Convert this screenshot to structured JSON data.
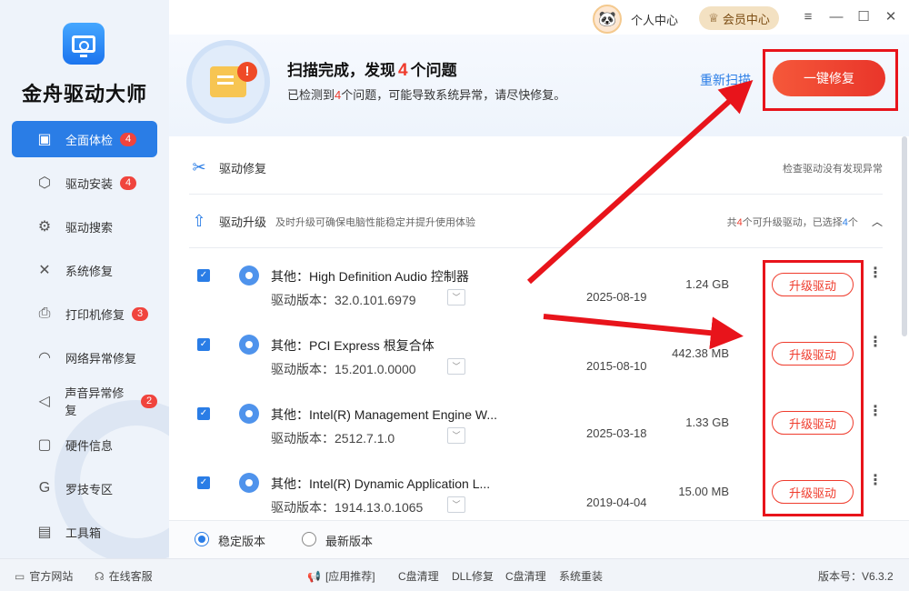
{
  "sidebar": {
    "app_name": "金舟驱动大师",
    "items": [
      {
        "label": "全面体检",
        "badge": "4",
        "icon": "monitor-icon"
      },
      {
        "label": "驱动安装",
        "badge": "4",
        "icon": "package-icon"
      },
      {
        "label": "驱动搜索",
        "badge": "",
        "icon": "search-gear-icon"
      },
      {
        "label": "系统修复",
        "badge": "",
        "icon": "tools-icon"
      },
      {
        "label": "打印机修复",
        "badge": "3",
        "icon": "printer-icon"
      },
      {
        "label": "网络异常修复",
        "badge": "",
        "icon": "wifi-icon"
      },
      {
        "label": "声音异常修复",
        "badge": "2",
        "icon": "speaker-icon"
      },
      {
        "label": "硬件信息",
        "badge": "",
        "icon": "chip-icon"
      },
      {
        "label": "罗技专区",
        "badge": "",
        "icon": "logitech-icon"
      },
      {
        "label": "工具箱",
        "badge": "",
        "icon": "toolbox-icon"
      }
    ]
  },
  "titlebar": {
    "personal_center": "个人中心",
    "vip_center": "会员中心"
  },
  "scan": {
    "title_prefix": "扫描完成，发现",
    "issue_count": "4",
    "title_suffix": "个问题",
    "sub_prefix": "已检测到",
    "sub_count": "4",
    "sub_suffix": "个问题，可能导致系统异常，请尽快修复。",
    "rescan_label": "重新扫描",
    "fix_all_label": "一键修复"
  },
  "sections": {
    "repair": {
      "title": "驱动修复",
      "right": "检查驱动没有发现异常"
    },
    "upgrade": {
      "title": "驱动升级",
      "desc": "及时升级可确保电脑性能稳定并提升使用体验",
      "right_1": "共",
      "right_count": "4",
      "right_2": "个可升级驱动，已选择",
      "right_selected": "4",
      "right_3": "个"
    }
  },
  "drivers": [
    {
      "name": "其他：High Definition Audio 控制器",
      "version": "驱动版本：32.0.101.6979",
      "date": "2025-08-19",
      "size": "1.24 GB",
      "action": "升级驱动"
    },
    {
      "name": "其他：PCI Express 根复合体",
      "version": "驱动版本：15.201.0.0000",
      "date": "2015-08-10",
      "size": "442.38 MB",
      "action": "升级驱动"
    },
    {
      "name": "其他：Intel(R) Management Engine W...",
      "version": "驱动版本：2512.7.1.0",
      "date": "2025-03-18",
      "size": "1.33 GB",
      "action": "升级驱动"
    },
    {
      "name": "其他：Intel(R) Dynamic Application L...",
      "version": "驱动版本：1914.13.0.1065",
      "date": "2019-04-04",
      "size": "15.00 MB",
      "action": "升级驱动"
    }
  ],
  "version_mode": {
    "stable": "稳定版本",
    "latest": "最新版本",
    "selected": "stable"
  },
  "footer": {
    "website": "官方网站",
    "support": "在线客服",
    "recommend": "[应用推荐]",
    "links": [
      "C盘清理",
      "DLL修复",
      "C盘清理",
      "系统重装"
    ],
    "version": "版本号：V6.3.2"
  },
  "colors": {
    "accent": "#2a7de6",
    "danger": "#ef3b2c",
    "annotation": "#e8141b"
  }
}
